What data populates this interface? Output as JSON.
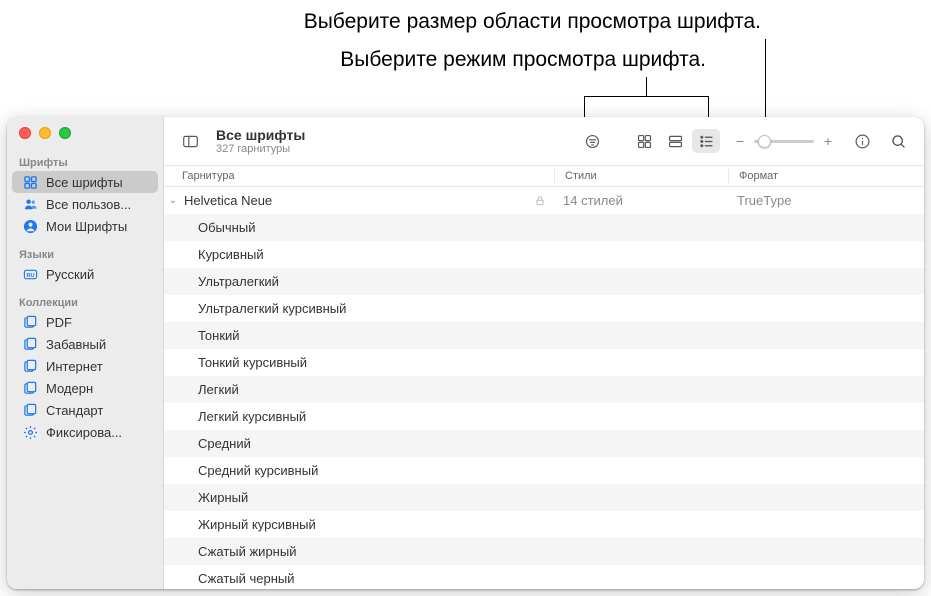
{
  "callouts": {
    "area": "Выберите размер области просмотра шрифта.",
    "mode": "Выберите режим просмотра шрифта."
  },
  "toolbar": {
    "title": "Все шрифты",
    "subtitle": "327 гарнитуры"
  },
  "sidebar": {
    "sections": [
      {
        "heading": "Шрифты",
        "items": [
          {
            "label": "Все шрифты",
            "icon": "grid",
            "selected": true
          },
          {
            "label": "Все пользов...",
            "icon": "person"
          },
          {
            "label": "Мои Шрифты",
            "icon": "avatar"
          }
        ]
      },
      {
        "heading": "Языки",
        "items": [
          {
            "label": "Русский",
            "icon": "ru"
          }
        ]
      },
      {
        "heading": "Коллекции",
        "items": [
          {
            "label": "PDF",
            "icon": "folder"
          },
          {
            "label": "Забавный",
            "icon": "folder"
          },
          {
            "label": "Интернет",
            "icon": "folder"
          },
          {
            "label": "Модерн",
            "icon": "folder"
          },
          {
            "label": "Стандарт",
            "icon": "folder"
          },
          {
            "label": "Фиксирова...",
            "icon": "gear"
          }
        ]
      }
    ]
  },
  "columns": {
    "c1": "Гарнитура",
    "c2": "Стили",
    "c3": "Формат"
  },
  "family": {
    "name": "Helvetica Neue",
    "styles_count": "14 стилей",
    "format": "TrueType",
    "styles": [
      "Обычный",
      "Курсивный",
      "Ультралегкий",
      "Ультралегкий курсивный",
      "Тонкий",
      "Тонкий курсивный",
      "Легкий",
      "Легкий курсивный",
      "Средний",
      "Средний курсивный",
      "Жирный",
      "Жирный курсивный",
      "Сжатый жирный",
      "Сжатый черный"
    ]
  }
}
